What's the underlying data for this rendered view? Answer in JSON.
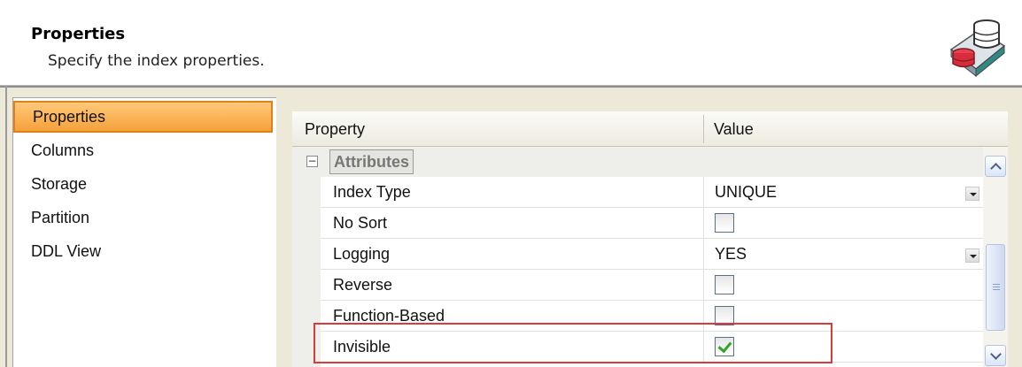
{
  "header": {
    "title": "Properties",
    "subtitle": "Specify the index properties.",
    "icon": "database-index-icon"
  },
  "nav": {
    "items": [
      {
        "label": "Properties",
        "selected": true
      },
      {
        "label": "Columns",
        "selected": false
      },
      {
        "label": "Storage",
        "selected": false
      },
      {
        "label": "Partition",
        "selected": false
      },
      {
        "label": "DDL View",
        "selected": false
      }
    ],
    "selected_color": "#f6a13a"
  },
  "grid": {
    "headers": {
      "property": "Property",
      "value": "Value"
    },
    "category": {
      "label": "Attributes",
      "expander": "−"
    },
    "rows": [
      {
        "name": "Index Type",
        "type": "dropdown",
        "value": "UNIQUE"
      },
      {
        "name": "No Sort",
        "type": "checkbox",
        "checked": false
      },
      {
        "name": "Logging",
        "type": "dropdown",
        "value": "YES"
      },
      {
        "name": "Reverse",
        "type": "checkbox",
        "checked": false
      },
      {
        "name": "Function-Based",
        "type": "checkbox",
        "checked": false
      },
      {
        "name": "Invisible",
        "type": "checkbox",
        "checked": true
      }
    ]
  },
  "highlight_color": "#d93a3a"
}
